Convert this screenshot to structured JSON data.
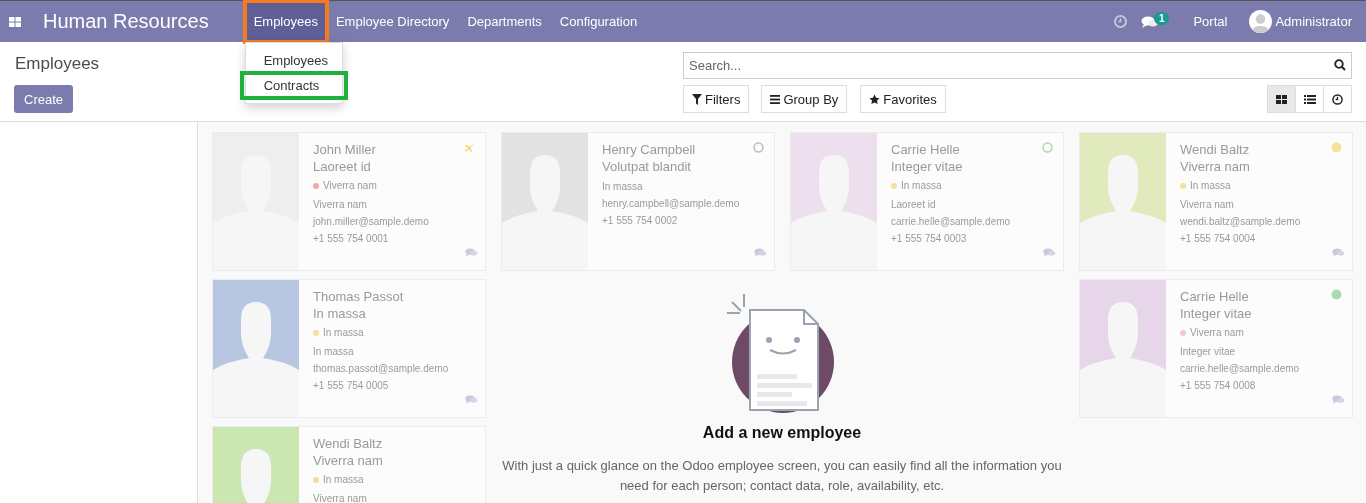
{
  "navbar": {
    "app_title": "Human Resources",
    "menu": [
      {
        "label": "Employees",
        "selected": true,
        "highlighted": true
      },
      {
        "label": "Employee Directory",
        "selected": false,
        "highlighted": false
      },
      {
        "label": "Departments",
        "selected": false,
        "highlighted": false
      },
      {
        "label": "Configuration",
        "selected": false,
        "highlighted": false
      }
    ],
    "dropdown": [
      {
        "label": "Employees",
        "highlighted": false
      },
      {
        "label": "Contracts",
        "highlighted": true
      }
    ],
    "chat_badge": "1",
    "portal": "Portal",
    "user": "Administrator"
  },
  "control_panel": {
    "breadcrumb": "Employees",
    "create": "Create",
    "search": {
      "placeholder": "Search..."
    },
    "filters": "Filters",
    "group_by": "Group By",
    "favorites": "Favorites",
    "views": [
      {
        "kind": "kanban",
        "selected": true
      },
      {
        "kind": "list",
        "selected": false
      },
      {
        "kind": "activity",
        "selected": false
      }
    ]
  },
  "cards": [
    {
      "name": "John Miller",
      "job": "Laoreet id",
      "tag": {
        "label": "Viverra nam",
        "color": "#f2a8a8"
      },
      "line": "Viverra nam",
      "email": "john.miller@sample.demo",
      "phone": "+1 555 754 0001",
      "avatar": {
        "color": "#eeeeee"
      },
      "presence": {
        "kind": "plane",
        "color": "#f6d77a"
      }
    },
    {
      "name": "Henry Campbell",
      "job": "Volutpat blandit",
      "line": "In massa",
      "email": "henry.campbell@sample.demo",
      "phone": "+1 555 754 0002",
      "avatar": {
        "color": "#e2e2e2"
      },
      "presence": {
        "kind": "ring",
        "color": "#bbbbbb"
      }
    },
    {
      "name": "Carrie Helle",
      "job": "Integer vitae",
      "tag": {
        "label": "In massa",
        "color": "#f6df9a"
      },
      "line": "Laoreet id",
      "email": "carrie.helle@sample.demo",
      "phone": "+1 555 754 0003",
      "avatar": {
        "color": "#eddfed"
      },
      "presence": {
        "kind": "ring",
        "color": "#a8dba8"
      }
    },
    {
      "name": "Wendi Baltz",
      "job": "Viverra nam",
      "tag": {
        "label": "In massa",
        "color": "#f6df9a"
      },
      "line": "Viverra nam",
      "email": "wendi.baltz@sample.demo",
      "phone": "+1 555 754 0004",
      "avatar": {
        "color": "#e1eabc"
      },
      "presence": {
        "kind": "dot",
        "color": "#f7e09a"
      }
    },
    {
      "name": "Thomas Passot",
      "job": "In massa",
      "tag": {
        "label": "In massa",
        "color": "#f6df9a"
      },
      "line": "In massa",
      "email": "thomas.passot@sample.demo",
      "phone": "+1 555 754 0005",
      "avatar": {
        "color": "#b7c7e1"
      }
    },
    {
      "name": "Carrie Helle",
      "job": "Integer vitae",
      "tag": {
        "label": "Viverra nam",
        "color": "#f6c9c9"
      },
      "line": "Integer vitae",
      "email": "carrie.helle@sample.demo",
      "phone": "+1 555 754 0008",
      "avatar": {
        "color": "#e7d5e9"
      },
      "presence": {
        "kind": "dot",
        "color": "#a8dcb0"
      }
    },
    {
      "name": "Wendi Baltz",
      "job": "Viverra nam",
      "tag": {
        "label": "In massa",
        "color": "#f6df9a"
      },
      "line": "Viverra nam",
      "avatar": {
        "color": "#cbe7b1"
      }
    }
  ],
  "helper": {
    "title": "Add a new employee",
    "text": "With just a quick glance on the Odoo employee screen, you can easily find all the information you need for each person; contact data, role, availability, etc."
  }
}
